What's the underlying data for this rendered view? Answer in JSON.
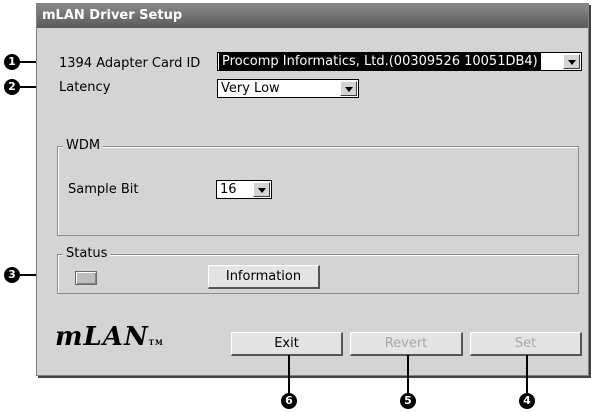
{
  "window": {
    "title": "mLAN Driver Setup"
  },
  "adapter": {
    "label": "1394 Adapter Card ID",
    "value": "Procomp Informatics, Ltd.(00309526 10051DB4)"
  },
  "latency": {
    "label": "Latency",
    "value": "Very Low"
  },
  "wdm": {
    "group_title": "WDM",
    "sample_bit_label": "Sample Bit",
    "sample_bit_value": "16"
  },
  "status": {
    "group_title": "Status",
    "information_label": "Information"
  },
  "buttons": {
    "exit": "Exit",
    "revert": "Revert",
    "set": "Set"
  },
  "logo": {
    "text": "mLAN",
    "tm": "TM"
  },
  "callouts": [
    "1",
    "2",
    "3",
    "4",
    "5",
    "6"
  ]
}
